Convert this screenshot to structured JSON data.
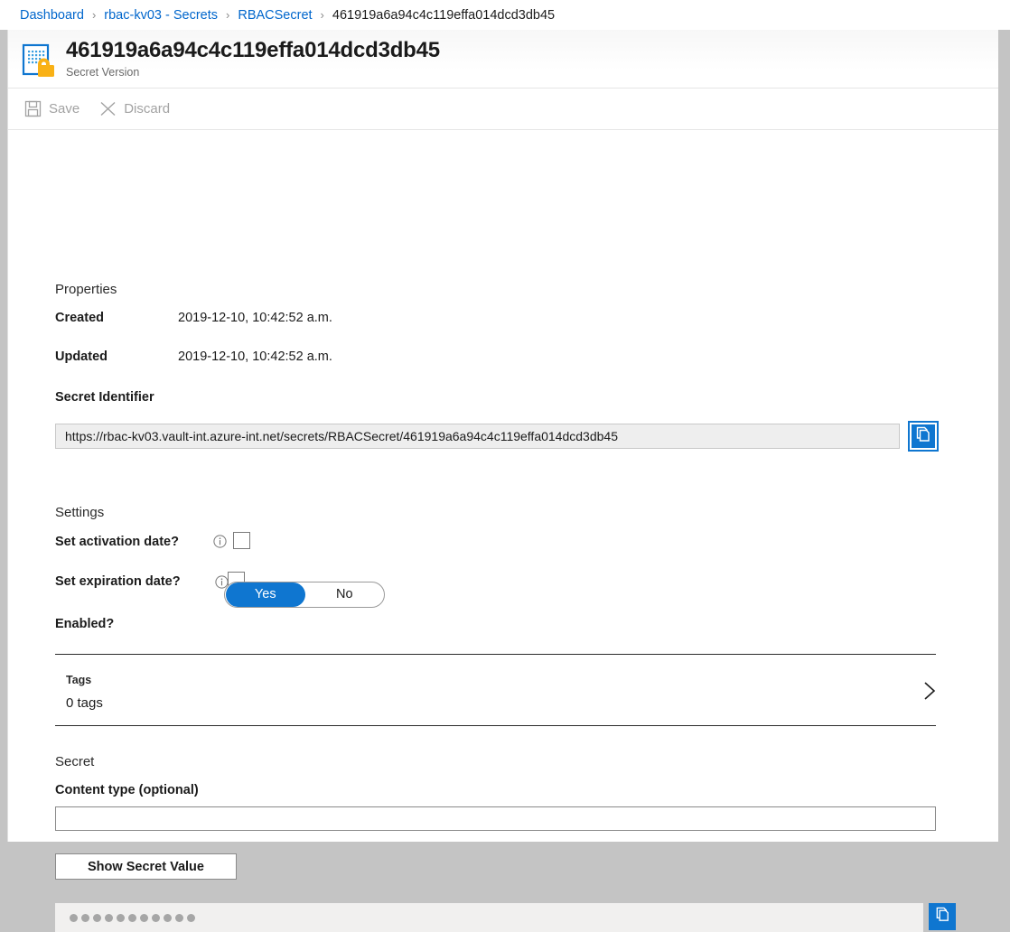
{
  "breadcrumb": {
    "items": [
      {
        "label": "Dashboard",
        "current": false
      },
      {
        "label": "rbac-kv03 - Secrets",
        "current": false
      },
      {
        "label": "RBACSecret",
        "current": false
      },
      {
        "label": "461919a6a94c4c119effa014dcd3db45",
        "current": true
      }
    ],
    "separator": "›"
  },
  "header": {
    "title": "461919a6a94c4c119effa014dcd3db45",
    "subtitle": "Secret Version",
    "icon": "secret-version-icon"
  },
  "toolbar": {
    "save_label": "Save",
    "save_icon": "save-icon",
    "discard_label": "Discard",
    "discard_icon": "discard-icon"
  },
  "properties": {
    "section_title": "Properties",
    "created_label": "Created",
    "created_value": "2019-12-10, 10:42:52 a.m.",
    "updated_label": "Updated",
    "updated_value": "2019-12-10, 10:42:52 a.m.",
    "identifier_label": "Secret Identifier",
    "identifier_value": "https://rbac-kv03.vault-int.azure-int.net/secrets/RBACSecret/461919a6a94c4c119effa014dcd3db45",
    "identifier_copy_icon": "copy-icon"
  },
  "settings": {
    "section_title": "Settings",
    "activation_label": "Set activation date?",
    "activation_info_icon": "info-icon",
    "activation_checked": false,
    "expiration_label": "Set expiration date?",
    "expiration_info_icon": "info-icon",
    "expiration_checked": false,
    "enabled_label": "Enabled?",
    "enabled_yes": "Yes",
    "enabled_no": "No",
    "enabled_selected": "Yes"
  },
  "tags": {
    "label": "Tags",
    "value": "0 tags",
    "chevron_icon": "chevron-right-icon"
  },
  "secret": {
    "section_title": "Secret",
    "content_type_label": "Content type (optional)",
    "content_type_value": "",
    "content_type_placeholder": "",
    "show_value_button": "Show Secret Value",
    "masked_value_dots": 11,
    "value_copy_icon": "copy-icon"
  },
  "colors": {
    "accent": "#0f76d0",
    "link": "#0066cc",
    "text": "#1b1b1b",
    "muted": "#a2a2a2",
    "icon_lock": "#f9b115",
    "panel_bg": "#ffffff",
    "page_bg": "#c4c4c4",
    "readonly_bg": "#eeeeee",
    "masked_bg": "#f1f0ef"
  }
}
